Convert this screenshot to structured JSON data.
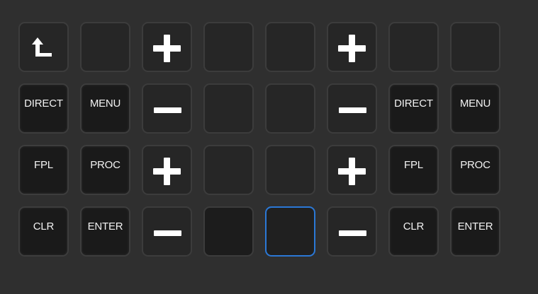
{
  "keypad": {
    "keys": [
      {
        "name": "back-key",
        "type": "icon",
        "icon": "return-up-arrow-icon",
        "label": ""
      },
      {
        "name": "blank-key-r1c2",
        "type": "blank",
        "label": ""
      },
      {
        "name": "increment-key-left-top",
        "type": "plus",
        "icon": "plus-icon",
        "label": ""
      },
      {
        "name": "blank-key-r1c4",
        "type": "blank",
        "label": ""
      },
      {
        "name": "blank-key-r1c5",
        "type": "blank",
        "label": ""
      },
      {
        "name": "increment-key-right-top",
        "type": "plus",
        "icon": "plus-icon",
        "label": ""
      },
      {
        "name": "blank-key-r1c7",
        "type": "blank",
        "label": ""
      },
      {
        "name": "blank-key-r1c8",
        "type": "blank",
        "label": ""
      },
      {
        "name": "direct-key-left",
        "type": "label",
        "label": "DIRECT"
      },
      {
        "name": "menu-key-left",
        "type": "label",
        "label": "MENU"
      },
      {
        "name": "decrement-key-left-top",
        "type": "minus",
        "icon": "minus-icon",
        "label": ""
      },
      {
        "name": "blank-key-r2c4",
        "type": "blank",
        "label": ""
      },
      {
        "name": "blank-key-r2c5",
        "type": "blank",
        "label": ""
      },
      {
        "name": "decrement-key-right-top",
        "type": "minus",
        "icon": "minus-icon",
        "label": ""
      },
      {
        "name": "direct-key-right",
        "type": "label",
        "label": "DIRECT"
      },
      {
        "name": "menu-key-right",
        "type": "label",
        "label": "MENU"
      },
      {
        "name": "fpl-key-left",
        "type": "label",
        "label": "FPL"
      },
      {
        "name": "proc-key-left",
        "type": "label",
        "label": "PROC"
      },
      {
        "name": "increment-key-left-bottom",
        "type": "plus",
        "icon": "plus-icon",
        "label": ""
      },
      {
        "name": "blank-key-r3c4",
        "type": "blank",
        "label": ""
      },
      {
        "name": "blank-key-r3c5",
        "type": "blank",
        "label": ""
      },
      {
        "name": "increment-key-right-bottom",
        "type": "plus",
        "icon": "plus-icon",
        "label": ""
      },
      {
        "name": "fpl-key-right",
        "type": "label",
        "label": "FPL"
      },
      {
        "name": "proc-key-right",
        "type": "label",
        "label": "PROC"
      },
      {
        "name": "clr-key-left",
        "type": "label",
        "label": "CLR"
      },
      {
        "name": "enter-key-left",
        "type": "label",
        "label": "ENTER"
      },
      {
        "name": "decrement-key-left-bottom",
        "type": "minus",
        "icon": "minus-icon",
        "label": ""
      },
      {
        "name": "blank-key-r4c4",
        "type": "dark",
        "label": ""
      },
      {
        "name": "blank-key-r4c5",
        "type": "selected",
        "label": ""
      },
      {
        "name": "decrement-key-right-bottom",
        "type": "minus",
        "icon": "minus-icon",
        "label": ""
      },
      {
        "name": "clr-key-right",
        "type": "label",
        "label": "CLR"
      },
      {
        "name": "enter-key-right",
        "type": "label",
        "label": "ENTER"
      }
    ]
  },
  "colors": {
    "background": "#2f2f2f",
    "key_face": "#262626",
    "key_border": "#3c3c3c",
    "selection_outline": "#2b78d6",
    "glyph": "#ffffff"
  }
}
